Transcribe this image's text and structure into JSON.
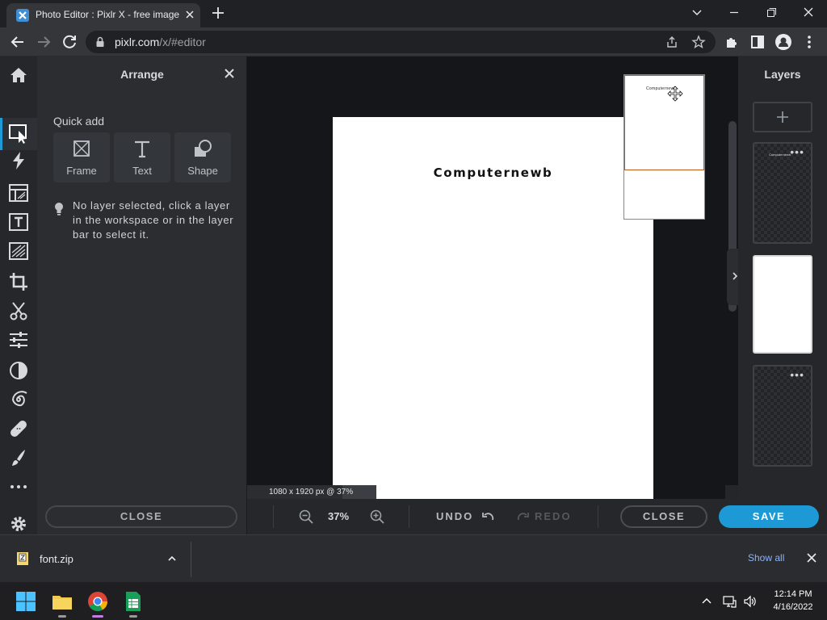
{
  "browser": {
    "tab_title": "Photo Editor : Pixlr X - free image",
    "url_domain": "pixlr.com",
    "url_path": "/x/#editor"
  },
  "left_rail": {
    "icons": [
      "home-icon",
      "arrange-icon",
      "quick-effects-icon",
      "layout-icon",
      "text-icon",
      "element-icon",
      "crop-icon",
      "cutout-icon",
      "adjust-icon",
      "filter-icon",
      "liquify-icon",
      "retouch-icon",
      "draw-icon",
      "more-icon",
      "settings-icon"
    ]
  },
  "arrange_panel": {
    "title": "Arrange",
    "quick_add_label": "Quick add",
    "tiles": [
      {
        "label": "Frame",
        "icon": "frame-icon"
      },
      {
        "label": "Text",
        "icon": "text-tool-icon"
      },
      {
        "label": "Shape",
        "icon": "shape-icon"
      }
    ],
    "hint": "No layer selected, click a layer in the workspace or in the layer bar to select it.",
    "close_label": "CLOSE"
  },
  "canvas": {
    "text": "Computernewb",
    "size_badge": "1080 x 1920 px @ 37%"
  },
  "bottom_bar": {
    "zoom_level": "37%",
    "undo_label": "UNDO",
    "redo_label": "REDO",
    "close_label": "CLOSE",
    "save_label": "SAVE",
    "accent_color": "#1d9ad6"
  },
  "layers_panel": {
    "title": "Layers",
    "more_glyph": "•••"
  },
  "downloads": {
    "file_name": "font.zip",
    "show_all_label": "Show all"
  },
  "taskbar": {
    "time": "12:14 PM",
    "date": "4/16/2022"
  }
}
